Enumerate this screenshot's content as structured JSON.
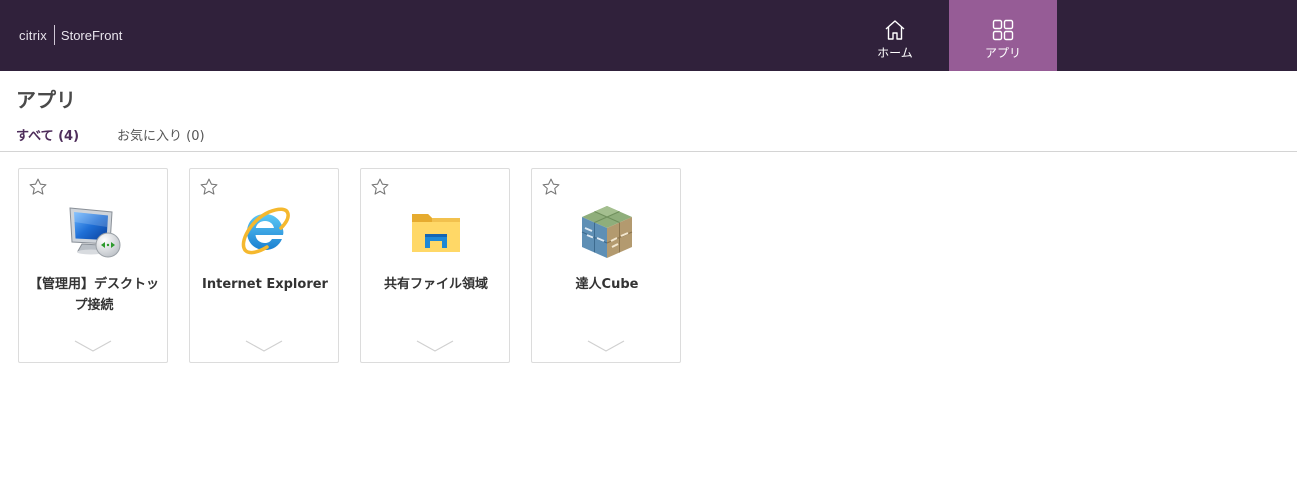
{
  "header": {
    "brand_citrix": "citrix",
    "brand_product": "StoreFront",
    "nav": [
      {
        "label": "ホーム",
        "icon": "home-icon",
        "active": false
      },
      {
        "label": "アプリ",
        "icon": "apps-grid-icon",
        "active": true
      }
    ]
  },
  "page": {
    "title": "アプリ",
    "tabs": [
      {
        "label": "すべて (4)",
        "active": true
      },
      {
        "label": "お気に入り (0)",
        "active": false
      }
    ]
  },
  "apps": [
    {
      "name": "【管理用】デスクトップ接続",
      "icon": "remote-desktop-icon",
      "favorite": false
    },
    {
      "name": "Internet Explorer",
      "icon": "internet-explorer-icon",
      "favorite": false
    },
    {
      "name": "共有ファイル領域",
      "icon": "folder-icon",
      "favorite": false
    },
    {
      "name": "達人Cube",
      "icon": "tatsujin-cube-icon",
      "favorite": false
    }
  ],
  "colors": {
    "topbar": "#30213b",
    "nav_active": "#965c96",
    "tab_active": "#4e2d5b"
  }
}
